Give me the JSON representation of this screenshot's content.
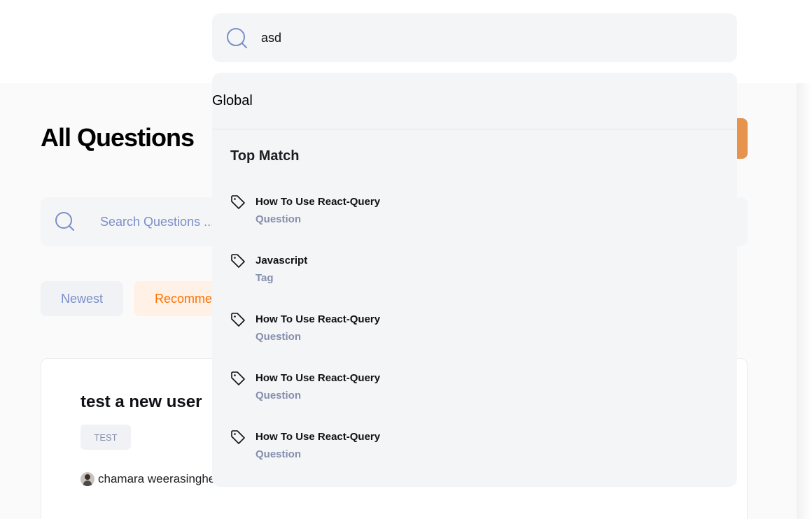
{
  "global_search": {
    "value": "asd"
  },
  "dropdown": {
    "global_label": "Global",
    "section_title": "Top Match",
    "results": [
      {
        "title": "How To Use React-Query",
        "type": "Question"
      },
      {
        "title": "Javascript",
        "type": "Tag"
      },
      {
        "title": "How To Use React-Query",
        "type": "Question"
      },
      {
        "title": "How To Use React-Query",
        "type": "Question"
      },
      {
        "title": "How To Use React-Query",
        "type": "Question"
      }
    ]
  },
  "main": {
    "page_title": "All Questions",
    "search_placeholder": "Search Questions ...",
    "filters": {
      "newest": "Newest",
      "recommended": "Recommen"
    },
    "question": {
      "title": "test a new user",
      "tag": "TEST",
      "author": "chamara weerasinghe"
    }
  },
  "colors": {
    "accent": "#ff7000",
    "ask_button": "#e5934d",
    "muted_text": "#858ead",
    "icon_blue": "#7b8ec8"
  }
}
